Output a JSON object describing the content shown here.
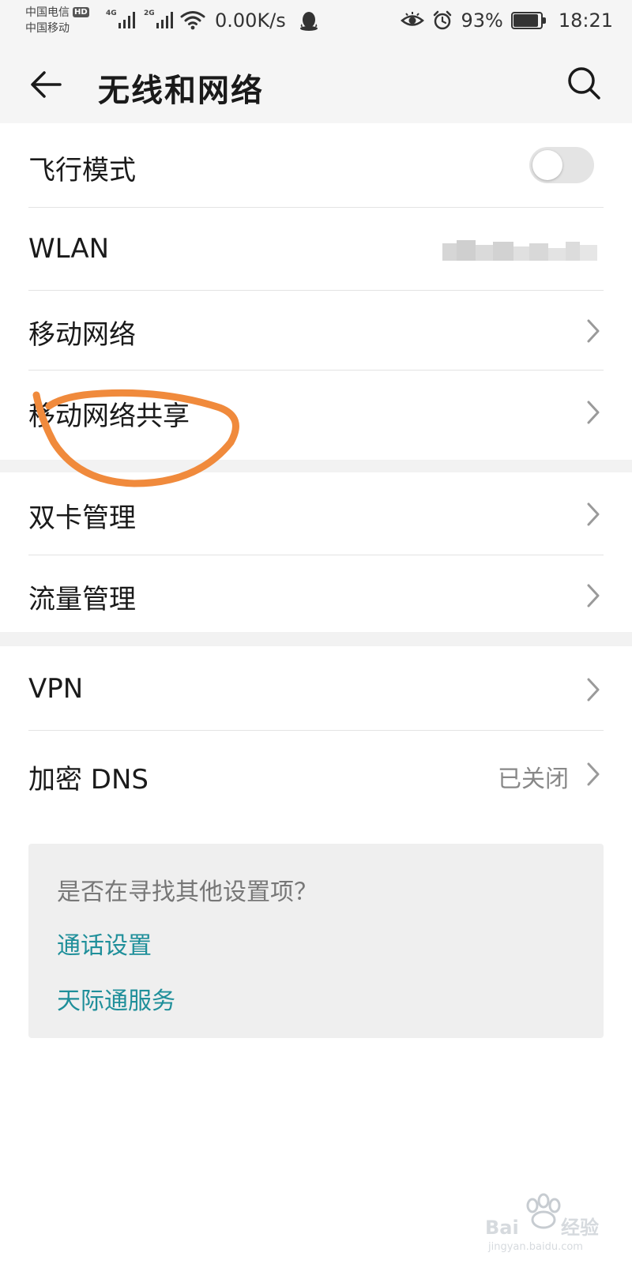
{
  "status_bar": {
    "carrier_1": "中国电信",
    "carrier_1_badge": "HD",
    "carrier_2": "中国移动",
    "signal_1_type": "4G",
    "signal_2_type": "2G",
    "net_speed": "0.00K/s",
    "battery_percent": "93%",
    "battery_level": 0.93,
    "time": "18:21",
    "icons": [
      "wifi-icon",
      "qq-penguin-icon",
      "eye-comfort-icon",
      "alarm-icon",
      "battery-icon"
    ]
  },
  "header": {
    "title": "无线和网络",
    "back_icon": "back-arrow-icon",
    "search_icon": "search-icon"
  },
  "sections": [
    {
      "items": [
        {
          "label": "飞行模式",
          "control": "toggle",
          "on": false
        },
        {
          "label": "WLAN",
          "value_redacted": true
        },
        {
          "label": "移动网络",
          "control": "chevron"
        },
        {
          "label": "移动网络共享",
          "control": "chevron"
        }
      ]
    },
    {
      "items": [
        {
          "label": "双卡管理",
          "control": "chevron"
        },
        {
          "label": "流量管理",
          "control": "chevron"
        }
      ]
    },
    {
      "items": [
        {
          "label": "VPN",
          "control": "chevron"
        },
        {
          "label": "加密 DNS",
          "value": "已关闭",
          "control": "chevron"
        }
      ]
    }
  ],
  "suggest": {
    "title": "是否在寻找其他设置项？",
    "links": [
      "通话设置",
      "天际通服务"
    ]
  },
  "colors": {
    "annotation_stroke": "#f08a3c",
    "link": "#1f8f9a",
    "background": "#f5f5f5"
  },
  "watermark": {
    "logo_text": "Baidu经验",
    "url": "jingyan.baidu.com"
  }
}
